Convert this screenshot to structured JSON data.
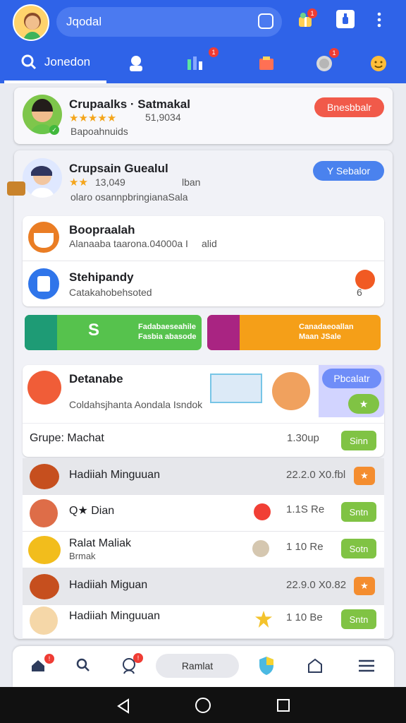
{
  "header": {
    "search_text": "Jqodal",
    "notifications_count": "1",
    "alerts_count": "1"
  },
  "tabs": [
    {
      "label": "Jonedon",
      "icon": "search-icon"
    },
    {
      "label": "",
      "icon": "profile-icon"
    },
    {
      "label": "",
      "icon": "chart-icon",
      "badge": "1"
    },
    {
      "label": "",
      "icon": "gift-icon"
    },
    {
      "label": "",
      "icon": "coin-icon",
      "badge": "1"
    },
    {
      "label": "",
      "icon": "smile-icon"
    }
  ],
  "profile_card": {
    "title": "Crupaalks · Satmakal",
    "rating_value": "51,9034",
    "subtitle": "Bapoahnuids",
    "button": "Bnesbbalr"
  },
  "group_card": {
    "title": "Crupsain Guealul",
    "rating_value": "13,049",
    "meta": "lban",
    "subtitle": "olaro osannpbringianaSala",
    "button": "Y Sebalor"
  },
  "info_items": [
    {
      "title": "Boopraalah",
      "subtitle": "Alanaaba taarona.04000a I",
      "suffix": "alid"
    },
    {
      "title": "Stehipandy",
      "subtitle": "Catakahobehsoted",
      "value": "6"
    }
  ],
  "promos": [
    {
      "label_left": "S",
      "line1": "Fadabaeseahile",
      "line2": "Fasbia abasode"
    },
    {
      "line1": "Canadaeoallan",
      "line2": "Maan JSale"
    }
  ],
  "detail_card": {
    "title": "Detanabe",
    "subtitle": "Coldahsjhanta Aondala Isndok",
    "button_top": "Pbcalatr",
    "button_bottom": "★"
  },
  "group_list": {
    "header": "Grupe: Machat",
    "header_value": "1.30up",
    "header_action": "Sinn"
  },
  "rows": [
    {
      "title": "Hadiiah Minguuan",
      "value": "22.2.0 X0.fbl",
      "action": "★",
      "alt": true
    },
    {
      "title": "Q★ Dian",
      "value": "1.1S Re",
      "action": "Sntn",
      "alt": false
    },
    {
      "title": "Ralat Maliak",
      "subtitle": "Brmak",
      "value": "1 10 Re",
      "action": "Sotn",
      "alt": false
    },
    {
      "title": "Hadiiah Miguan",
      "value": "22.9.0 X0.82",
      "action": "★",
      "alt": true
    },
    {
      "title": "Hadiiah Minguuan",
      "value": "1 10 Be",
      "action": "Sntn",
      "alt": false
    }
  ],
  "bottom_nav": {
    "items": [
      "home-icon",
      "search-icon",
      "friends-icon",
      "shield-icon",
      "house-icon",
      "menu-icon"
    ],
    "center_label": "Ramlat"
  },
  "colors": {
    "brand": "#2f63e8",
    "accent_red": "#f15a4a",
    "accent_green": "#76c442",
    "accent_orange": "#f48d2f"
  }
}
